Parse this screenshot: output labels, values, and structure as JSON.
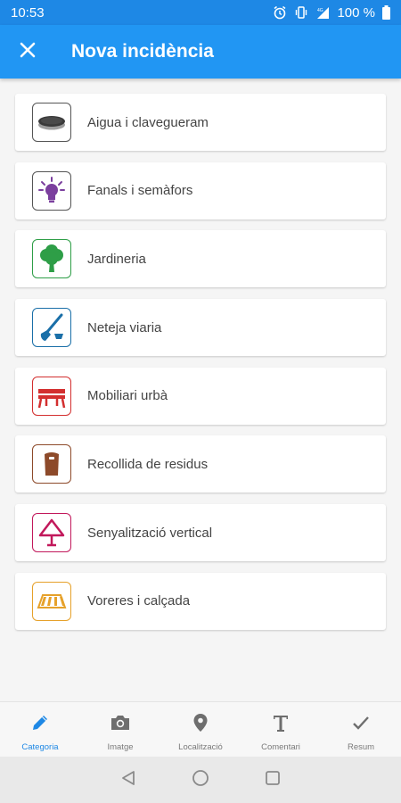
{
  "status_bar": {
    "time": "10:53",
    "battery": "100 %"
  },
  "app_bar": {
    "title": "Nova incidència"
  },
  "categories": [
    {
      "label": "Aigua i clavegueram",
      "icon": "manhole-icon",
      "color": "#555555"
    },
    {
      "label": "Fanals i semàfors",
      "icon": "lightbulb-icon",
      "color": "#7b3f9e"
    },
    {
      "label": "Jardineria",
      "icon": "tree-icon",
      "color": "#2e9e47"
    },
    {
      "label": "Neteja viaria",
      "icon": "broom-icon",
      "color": "#1a6fa8"
    },
    {
      "label": "Mobiliari urbà",
      "icon": "bench-icon",
      "color": "#d32f2f"
    },
    {
      "label": "Recollida de residus",
      "icon": "waste-bin-icon",
      "color": "#8d4a2a"
    },
    {
      "label": "Senyalització vertical",
      "icon": "road-sign-icon",
      "color": "#c2185b"
    },
    {
      "label": "Voreres i calçada",
      "icon": "crosswalk-icon",
      "color": "#e6a12a"
    }
  ],
  "bottom_nav": [
    {
      "label": "Categoria",
      "icon": "pencil-icon",
      "active": true
    },
    {
      "label": "Imatge",
      "icon": "camera-icon",
      "active": false
    },
    {
      "label": "Localització",
      "icon": "location-pin-icon",
      "active": false
    },
    {
      "label": "Comentari",
      "icon": "text-icon",
      "active": false
    },
    {
      "label": "Resum",
      "icon": "check-icon",
      "active": false
    }
  ],
  "colors": {
    "primary": "#2196f3",
    "status_bar": "#1e88e5",
    "active_nav": "#1e88e5"
  }
}
